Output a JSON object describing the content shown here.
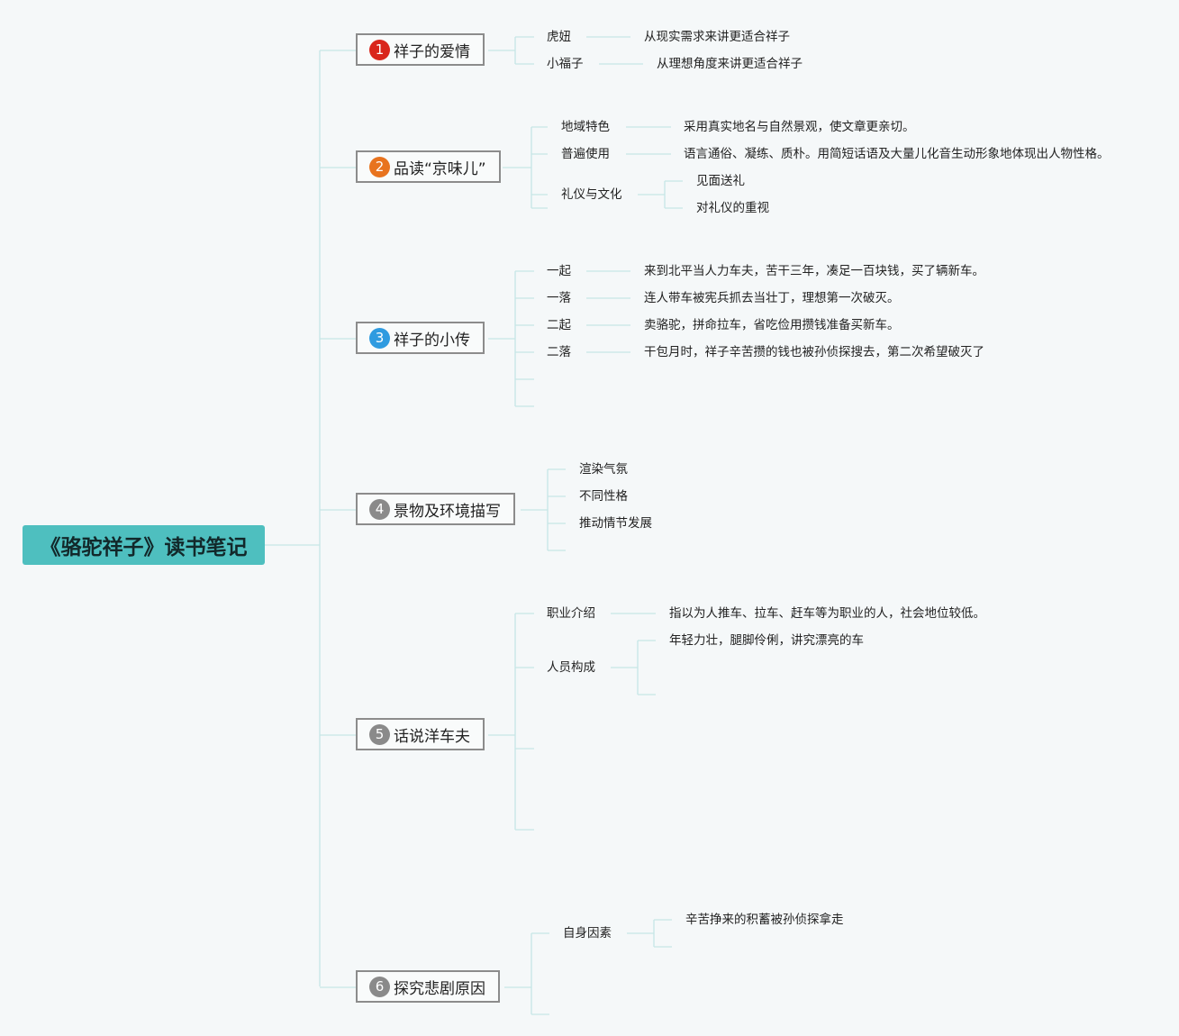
{
  "root": {
    "title": "《骆驼祥子》读书笔记"
  },
  "colors": {
    "line": "#c6e6e6",
    "root_bg": "#4ebfbf"
  },
  "branches": [
    {
      "num": "1",
      "label": "祥子的爱情",
      "badge_color": "#d9261c"
    },
    {
      "num": "2",
      "label": "品读“京味儿”",
      "badge_color": "#e8731e"
    },
    {
      "num": "3",
      "label": "祥子的小传",
      "badge_color": "#2f9be0"
    },
    {
      "num": "4",
      "label": "景物及环境描写",
      "badge_color": "#8a8a8a"
    },
    {
      "num": "5",
      "label": "话说洋车夫",
      "badge_color": "#8a8a8a"
    },
    {
      "num": "6",
      "label": "探究悲剧原因",
      "badge_color": "#8a8a8a"
    }
  ],
  "topics": {
    "love": [
      {
        "name": "虎妞",
        "detail": "从现实需求来讲更适合祥子"
      },
      {
        "name": "小福子",
        "detail": "从理想角度来讲更适合祥子"
      }
    ],
    "jingwei": [
      {
        "name": "地域特色",
        "detail": "采用真实地名与自然景观，使文章更亲切。"
      },
      {
        "name": "普遍使用",
        "detail": "语言通俗、凝练、质朴。用简短话语及大量儿化音生动形象地体现出人物性格。"
      },
      {
        "name": "礼仪与文化",
        "subs": [
          "见面送礼",
          "对礼仪的重视"
        ]
      }
    ],
    "bio": [
      {
        "name": "一起",
        "detail": "来到北平当人力车夫，苦干三年，凑足一百块钱，买了辆新车。"
      },
      {
        "name": "一落",
        "detail": "连人带车被宪兵抓去当壮丁，理想第一次破灭。"
      },
      {
        "name": "二起",
        "detail": "卖骆驼，拼命拉车，省吃俭用攒钱准备买新车。"
      },
      {
        "name": "二落",
        "detail": "干包月时，祥子辛苦攒的钱也被孙侦探搜去，第二次希望破灭了"
      }
    ],
    "scenery": [
      "渲染气氛",
      "不同性格",
      "推动情节发展"
    ],
    "puller": [
      {
        "name": "职业介绍",
        "detail": "指以为人推车、拉车、赶车等为职业的人，社会地位较低。"
      },
      {
        "name": "人员构成",
        "subs": [
          "年轻力壮，腿脚伶俐，讲究漂亮的车"
        ]
      }
    ],
    "tragedy": [
      {
        "name": "自身因素",
        "subs": [
          "辛苦挣来的积蓄被孙侦探拿走"
        ]
      }
    ]
  }
}
